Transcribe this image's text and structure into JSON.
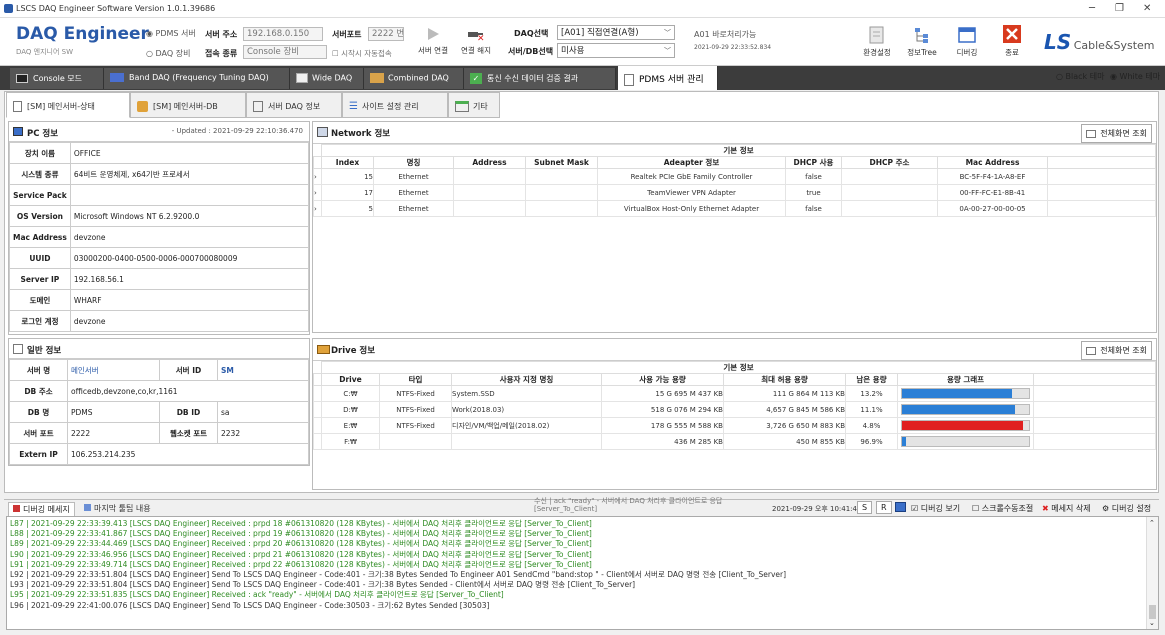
{
  "window": {
    "title": "LSCS DAQ Engineer Software Version 1.0.1.39686"
  },
  "brand": {
    "name": "DAQ Engineer",
    "sub": "DAQ 엔지니어 SW"
  },
  "ribbon": {
    "pdms_server": "PDMS 서버",
    "daq_device": "DAQ 장비",
    "server_addr_label": "서버 주소",
    "server_addr": "192.168.0.150",
    "server_port_label": "서버포트",
    "server_port": "2222 번",
    "conn_type_label": "접속 종류",
    "conn_type": "Console 장비",
    "auto_connect": "시작시 자동접속",
    "connect": "서버 연결",
    "disconnect": "연결 해지",
    "daq_select_label": "DAQ선택",
    "daq_select": "[A01] 직접연결(A형)",
    "server_db_label": "서버/DB선택",
    "server_db": "미사용",
    "status_line1": "A01 바로처리가능",
    "status_line2": "2021-09-29 22:33:52.834",
    "env_settings": "환경설정",
    "info_tree": "정보Tree",
    "debug": "디버깅",
    "exit": "종료",
    "ls_logo": "LS",
    "ls_sub": "Cable&System"
  },
  "main_tabs": [
    {
      "label": "Console 모드"
    },
    {
      "label": "Band DAQ (Frequency Tuning DAQ)"
    },
    {
      "label": "Wide DAQ"
    },
    {
      "label": "Combined DAQ"
    },
    {
      "label": "통신 수신 데이터 검증 결과"
    },
    {
      "label": "PDMS 서버 관리"
    }
  ],
  "theme": {
    "black": "Black 테마",
    "white": "White 테마"
  },
  "sub_tabs": [
    {
      "label": "[SM] 메인서버-상태"
    },
    {
      "label": "[SM] 메인서버-DB"
    },
    {
      "label": "서버 DAQ 정보"
    },
    {
      "label": "사이트 설정 관리"
    },
    {
      "label": "기타"
    }
  ],
  "pc_info": {
    "title": "PC 정보",
    "updated": "- Updated : 2021-09-29 22:10:36.470",
    "rows": [
      {
        "k": "장치 이름",
        "v": "OFFICE"
      },
      {
        "k": "시스템 종류",
        "v": "64비트 운영체제, x64기반 프로세서"
      },
      {
        "k": "Service Pack",
        "v": ""
      },
      {
        "k": "OS Version",
        "v": "Microsoft Windows NT 6.2.9200.0"
      },
      {
        "k": "Mac Address",
        "v": "devzone"
      },
      {
        "k": "UUID",
        "v": "03000200-0400-0500-0006-000700080009"
      },
      {
        "k": "Server IP",
        "v": "192.168.56.1"
      },
      {
        "k": "도메인",
        "v": "WHARF"
      },
      {
        "k": "로그인 계정",
        "v": "devzone"
      }
    ]
  },
  "general_info": {
    "title": "일반 정보",
    "server_name_k": "서버 명",
    "server_name_v": "메인서버",
    "server_id_k": "서버 ID",
    "server_id_v": "SM",
    "db_addr_k": "DB 주소",
    "db_addr_v": "officedb,devzone,co,kr,1161",
    "db_name_k": "DB 명",
    "db_name_v": "PDMS",
    "db_id_k": "DB ID",
    "db_id_v": "sa",
    "srv_port_k": "서버 포트",
    "srv_port_v": "2222",
    "ws_port_k": "웹소켓 포트",
    "ws_port_v": "2232",
    "extern_ip_k": "Extern IP",
    "extern_ip_v": "106.253.214.235"
  },
  "network": {
    "title": "Network 정보",
    "fullscreen": "전체화면 조회",
    "group": "기본 정보",
    "columns": [
      "Index",
      "명칭",
      "Address",
      "Subnet Mask",
      "Adeapter 정보",
      "DHCP 사용",
      "DHCP 주소",
      "Mac Address"
    ],
    "rows": [
      [
        "15",
        "Ethernet",
        "",
        "",
        "Realtek PCIe GbE Family Controller",
        "false",
        "",
        "BC-5F-F4-1A-A8-EF"
      ],
      [
        "17",
        "Ethernet",
        "",
        "",
        "TeamViewer VPN Adapter",
        "true",
        "",
        "00-FF-FC-E1-8B-41"
      ],
      [
        "5",
        "Ethernet",
        "",
        "",
        "VirtualBox Host-Only Ethernet Adapter",
        "false",
        "",
        "0A-00-27-00-00-05"
      ]
    ]
  },
  "drive": {
    "title": "Drive 정보",
    "fullscreen": "전체화면 조회",
    "group": "기본 정보",
    "columns": [
      "Drive",
      "타입",
      "사용자 지정 명칭",
      "사용 가능 용량",
      "최대 허용 용량",
      "남은 용량",
      "용량 그래프"
    ],
    "rows": [
      {
        "drive": "C:₩",
        "type": "NTFS-Fixed",
        "name": "System.SSD",
        "free": "15 G 695 M 437 KB",
        "max": "111 G 864 M 113 KB",
        "remain": "13.2%",
        "used_pct": 86.8,
        "color": "#2b7fd6"
      },
      {
        "drive": "D:₩",
        "type": "NTFS-Fixed",
        "name": "Work(2018.03)",
        "free": "518 G 076 M 294 KB",
        "max": "4,657 G 845 M 586 KB",
        "remain": "11.1%",
        "used_pct": 88.9,
        "color": "#2b7fd6"
      },
      {
        "drive": "E:₩",
        "type": "NTFS-Fixed",
        "name": "디자인/VM/백업/메일(2018.02)",
        "free": "178 G 555 M 588 KB",
        "max": "3,726 G 650 M 883 KB",
        "remain": "4.8%",
        "used_pct": 95.2,
        "color": "#e02020"
      },
      {
        "drive": "F:₩",
        "type": "",
        "name": "",
        "free": "436 M 285 KB",
        "max": "450 M 855 KB",
        "remain": "96.9%",
        "used_pct": 3.1,
        "color": "#2b7fd6"
      }
    ]
  },
  "debug": {
    "tab_msg": "디버깅 메세지",
    "tab_tip": "마지막 툴팁 내용",
    "tip_line1": "수신 | ack \"ready\" - 서버에서 DAQ 처리후 클라이언트로 응답",
    "tip_line2": "[Server_To_Client]",
    "time": "2021-09-29 오후 10:41:44",
    "s": "S",
    "r": "R",
    "debug_view": "디버깅 보기",
    "scroll_manual": "스크롤수동조절",
    "msg_delete": "메세지 삭제",
    "debug_settings": "디버깅 설정",
    "lines": [
      {
        "t": "L87 | 2021-09-29 22:33:39.413 [LSCS DAQ Engineer] Received  : prpd 18 #061310820 (128 KBytes) - 서버에서 DAQ 처리후 클라이언트로 응답 [Server_To_Client]",
        "c": "#2e8b22"
      },
      {
        "t": "L88 | 2021-09-29 22:33:41.867 [LSCS DAQ Engineer] Received  : prpd 19 #061310820 (128 KBytes) - 서버에서 DAQ 처리후 클라이언트로 응답 [Server_To_Client]",
        "c": "#2e8b22"
      },
      {
        "t": "L89 | 2021-09-29 22:33:44.469 [LSCS DAQ Engineer] Received  : prpd 20 #061310820 (128 KBytes) - 서버에서 DAQ 처리후 클라이언트로 응답 [Server_To_Client]",
        "c": "#2e8b22"
      },
      {
        "t": "L90 | 2021-09-29 22:33:46.956 [LSCS DAQ Engineer] Received  : prpd 21 #061310820 (128 KBytes) - 서버에서 DAQ 처리후 클라이언트로 응답 [Server_To_Client]",
        "c": "#2e8b22"
      },
      {
        "t": "L91 | 2021-09-29 22:33:49.714 [LSCS DAQ Engineer] Received  : prpd 22 #061310820 (128 KBytes) - 서버에서 DAQ 처리후 클라이언트로 응답 [Server_To_Client]",
        "c": "#2e8b22"
      },
      {
        "t": "L92 | 2021-09-29 22:33:51.804 [LSCS DAQ Engineer] Send To LSCS DAQ Engineer - Code:401 - 크기:38 Bytes Sended To Engineer A01 SendCmd \"band:stop \" - Client에서 서버로 DAQ 명령 전송 [Client_To_Server]",
        "c": "#333"
      },
      {
        "t": "L93 | 2021-09-29 22:33:51.804 [LSCS DAQ Engineer] Send To LSCS DAQ Engineer - Code:401 - 크기:38 Bytes Sended - Client에서 서버로 DAQ 명령 전송 [Client_To_Server]",
        "c": "#333"
      },
      {
        "t": "L95 | 2021-09-29 22:33:51.835 [LSCS DAQ Engineer] Received  : ack \"ready\" - 서버에서 DAQ 처리후 클라이언트로 응답 [Server_To_Client]",
        "c": "#2e8b22"
      },
      {
        "t": "L96 | 2021-09-29 22:41:00.076 [LSCS DAQ Engineer] Send To LSCS DAQ Engineer - Code:30503 - 크기:62 Bytes Sended [30503]",
        "c": "#333"
      }
    ]
  }
}
